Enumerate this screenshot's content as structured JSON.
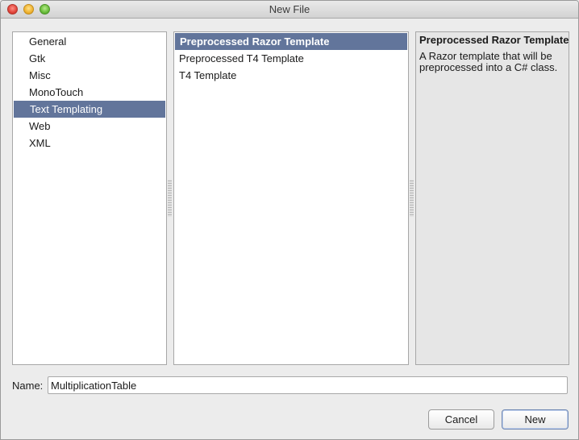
{
  "window": {
    "title": "New File"
  },
  "categories": {
    "items": [
      {
        "label": "General",
        "selected": false
      },
      {
        "label": "Gtk",
        "selected": false
      },
      {
        "label": "Misc",
        "selected": false
      },
      {
        "label": "MonoTouch",
        "selected": false
      },
      {
        "label": "Text Templating",
        "selected": true
      },
      {
        "label": "Web",
        "selected": false
      },
      {
        "label": "XML",
        "selected": false
      }
    ]
  },
  "templates": {
    "items": [
      {
        "label": "Preprocessed Razor Template",
        "selected": true
      },
      {
        "label": "Preprocessed T4 Template",
        "selected": false
      },
      {
        "label": "T4 Template",
        "selected": false
      }
    ]
  },
  "details": {
    "title": "Preprocessed Razor Template",
    "description": "A Razor template that will be preprocessed into a C# class."
  },
  "name_field": {
    "label": "Name:",
    "value": "MultiplicationTable"
  },
  "buttons": {
    "cancel": "Cancel",
    "new": "New"
  },
  "colors": {
    "selection": "#62759b",
    "window_bg": "#ececec"
  }
}
